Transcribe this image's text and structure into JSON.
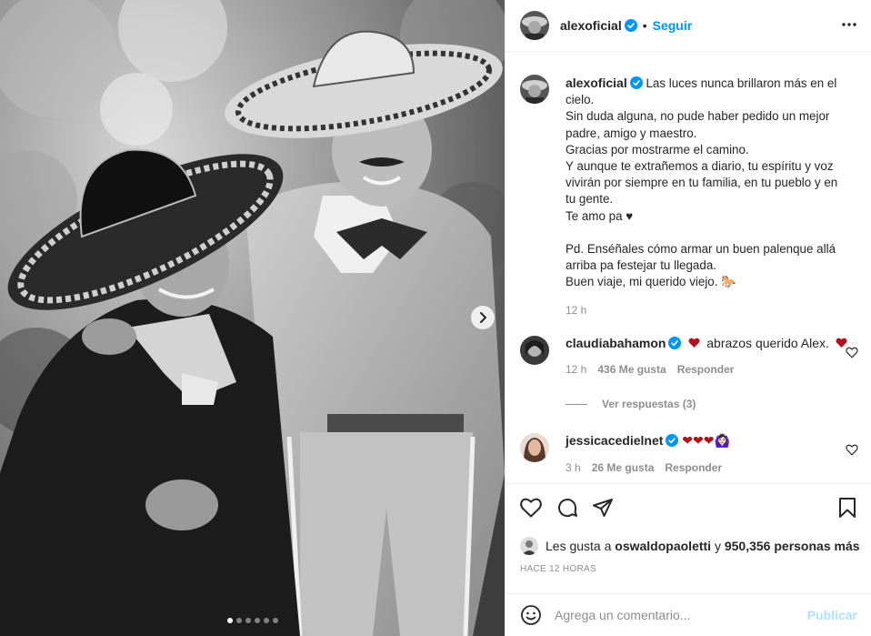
{
  "post": {
    "account": "alexoficial",
    "follow_label": "Seguir",
    "header_separator": "•",
    "icons": {
      "verified": "verified-badge-icon",
      "more": "more-options-icon",
      "next": "chevron-right-icon",
      "like": "heart-outline-icon",
      "comment": "comment-bubble-icon",
      "share": "paper-plane-icon",
      "save": "bookmark-icon",
      "emoji": "smiley-icon"
    },
    "colors": {
      "accent": "#0095f6",
      "publish_disabled": "#b2dffc",
      "verified": "#0095f6",
      "heart_emoji": "#b3101a",
      "muted": "#8e8e8e"
    },
    "carousel": {
      "slides": 6,
      "active_index": 0
    }
  },
  "caption": {
    "username": "alexoficial",
    "lines_a": [
      "Las luces nunca brillaron más en el",
      "cielo.",
      "Sin duda alguna, no pude haber pedido un mejor",
      "padre, amigo y maestro.",
      "Gracias por mostrarme el camino.",
      "Y aunque te extrañemos a diario, tu espíritu y voz",
      "vivirán por siempre en tu familia, en tu pueblo y en",
      "tu gente.",
      "Te amo pa ♥"
    ],
    "lines_b": [
      "Pd. Enséñales cómo armar un buen palenque allá",
      "arriba pa festejar tu llegada.",
      "Buen viaje, mi querido viejo. 🐎"
    ],
    "time": "12 h"
  },
  "comments": [
    {
      "username": "claudiabahamon",
      "text": "abrazos querido Alex.",
      "time": "12 h",
      "likes": "436 Me gusta",
      "reply": "Responder"
    },
    {
      "username": "jessicacedielnet",
      "text": "❤❤❤🙆🏻‍♀️",
      "time": "3 h",
      "likes": "26 Me gusta",
      "reply": "Responder"
    }
  ],
  "view_replies": "Ver respuestas (3)",
  "likes": {
    "prefix": "Les gusta a",
    "user": "oswaldopaoletti",
    "joiner": "y",
    "count_text": "950,356 personas más"
  },
  "posted_ago": "HACE 12 HORAS",
  "composer": {
    "placeholder": "Agrega un comentario...",
    "publish_label": "Publicar"
  }
}
